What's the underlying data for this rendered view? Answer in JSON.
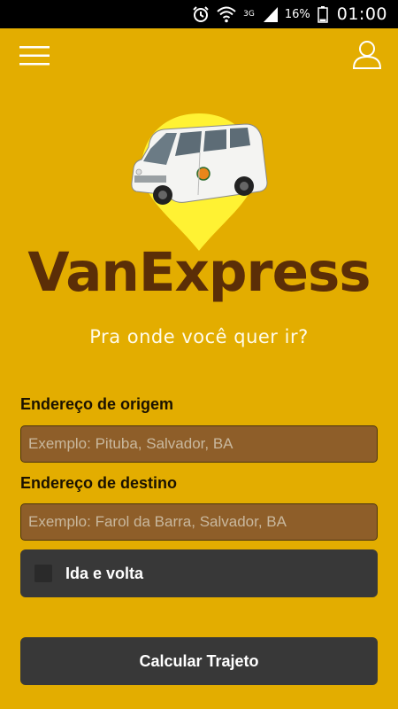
{
  "status_bar": {
    "icons": [
      "alarm-icon",
      "wifi-icon",
      "network-3g-icon",
      "signal-icon",
      "battery-icon"
    ],
    "network_type": "3G",
    "battery": "16%",
    "time": "01:00"
  },
  "header": {
    "menu_icon": "hamburger-menu-icon",
    "user_icon": "user-profile-icon"
  },
  "logo": {
    "icon": "van-location-pin-icon",
    "title": "VanExpress",
    "tagline": "Pra onde você quer ir?"
  },
  "form": {
    "origin": {
      "label": "Endereço de origem",
      "placeholder": "Exemplo: Pituba, Salvador, BA",
      "value": ""
    },
    "destination": {
      "label": "Endereço de destino",
      "placeholder": "Exemplo: Farol da Barra, Salvador, BA",
      "value": ""
    },
    "round_trip": {
      "label": "Ida e volta",
      "checked": false
    },
    "submit_label": "Calcular Trajeto"
  },
  "colors": {
    "background": "#e3ad00",
    "title": "#5b2e07",
    "field_background": "#8e5e29",
    "button_background": "#383838",
    "pin": "#fff233"
  }
}
